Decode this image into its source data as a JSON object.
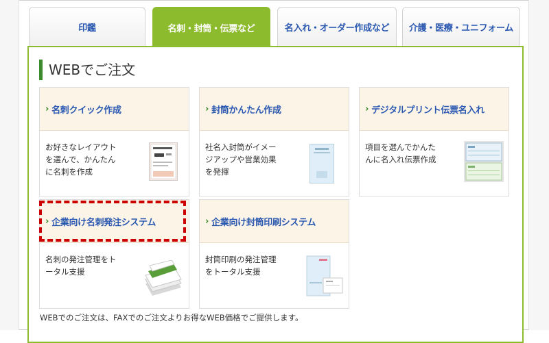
{
  "tabs": [
    {
      "label": "印鑑"
    },
    {
      "label": "名刺・封筒・伝票など"
    },
    {
      "label": "名入れ・オーダー作成など"
    },
    {
      "label": "介護・医療・ユニフォーム"
    }
  ],
  "active_tab": "名刺・封筒・伝票など",
  "section_title": "WEBでご注文",
  "cards": [
    {
      "title": "名刺クイック作成",
      "desc": [
        "お好きなレイアウト",
        "を選んで、かんたん",
        "に名刺を作成"
      ],
      "thumb_icon": "business-card-thumbnail"
    },
    {
      "title": "封筒かんたん作成",
      "desc": [
        "社名入封筒がイメー",
        "ジアップや営業効果",
        "を発揮"
      ],
      "thumb_icon": "envelope-thumbnail"
    },
    {
      "title": "デジタルプリント伝票名入れ",
      "desc": [
        "項目を選んでかんた",
        "んに名入れ伝票作成"
      ],
      "thumb_icon": "slip-thumbnail"
    },
    {
      "title": "企業向け名刺発注システム",
      "desc": [
        "名刺の発注管理をト",
        "ータル支援"
      ],
      "thumb_icon": "card-stack-thumbnail"
    },
    {
      "title": "企業向け封筒印刷システム",
      "desc": [
        "封筒印刷の発注管理",
        "をトータル支援"
      ],
      "thumb_icon": "envelope-set-thumbnail"
    }
  ],
  "footer_note": "WEBでのご注文は、FAXでのご注文よりお得なWEB価格でご提供します。",
  "colors": {
    "accent_green": "#8dbb2e",
    "title_bar": "#3b8a2b",
    "link_blue": "#2a58b0",
    "card_head_bg": "#fdf4e8",
    "highlight_red": "#cc0000"
  }
}
